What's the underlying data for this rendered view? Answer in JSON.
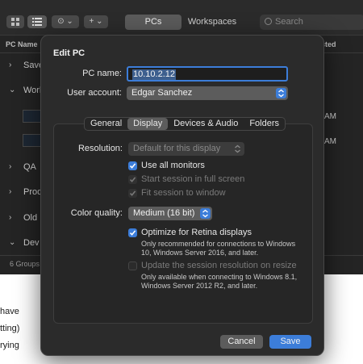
{
  "background": {
    "toolbar": {
      "segments": [
        "PCs",
        "Workspaces"
      ],
      "search_placeholder": "Search"
    },
    "columns": [
      "PC Name",
      "cted"
    ],
    "groups": [
      {
        "label": "Save",
        "chevron": "›"
      },
      {
        "label": "Work",
        "chevron": "⌄"
      },
      {
        "label": "QA",
        "chevron": "›"
      },
      {
        "label": "Prod",
        "chevron": "›"
      },
      {
        "label": "Old F",
        "chevron": "›"
      },
      {
        "label": "Dev",
        "chevron": "⌄"
      }
    ],
    "row_stamps": [
      "AM",
      "AM"
    ],
    "status": "6 Groups",
    "doc_fragments": [
      "have",
      "tting)",
      "rying"
    ]
  },
  "dialog": {
    "title": "Edit PC",
    "pc_name_label": "PC name:",
    "pc_name_value": "10.10.2.12",
    "user_account_label": "User account:",
    "user_account_value": "Edgar Sanchez",
    "tabs": [
      "General",
      "Display",
      "Devices & Audio",
      "Folders"
    ],
    "selected_tab": "Display",
    "resolution_label": "Resolution:",
    "resolution_value": "Default for this display",
    "use_all_monitors": {
      "label": "Use all monitors",
      "checked": true
    },
    "start_fullscreen": {
      "label": "Start session in full screen",
      "checked": true,
      "disabled": true
    },
    "fit_window": {
      "label": "Fit session to window",
      "checked": true,
      "disabled": true
    },
    "color_quality_label": "Color quality:",
    "color_quality_value": "Medium (16 bit)",
    "optimize_retina": {
      "label": "Optimize for Retina displays",
      "checked": true,
      "note": "Only recommended for connections to Windows 10, Windows Server 2016, and later."
    },
    "update_resolution": {
      "label": "Update the session resolution on resize",
      "checked": false,
      "disabled": true,
      "note": "Only available when connecting to Windows 8.1, Windows Server 2012 R2, and later."
    },
    "cancel_label": "Cancel",
    "save_label": "Save"
  },
  "colors": {
    "accent": "#3c7dd9",
    "dialog_bg": "#2b2b2b",
    "panel_bg": "#262626"
  }
}
